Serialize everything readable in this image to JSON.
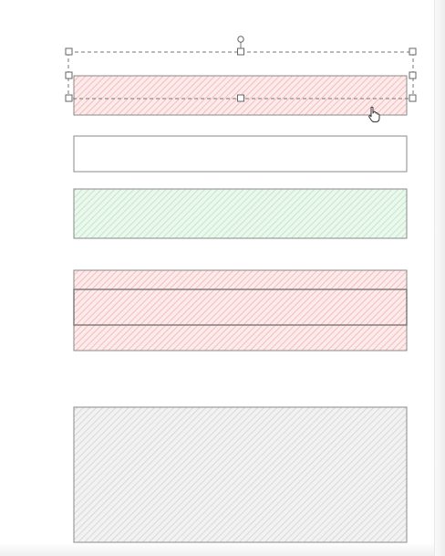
{
  "canvas": {
    "background": "#ffffff",
    "shapes": [
      {
        "name": "shape-red-hatched-selected",
        "fill": "red-hatch",
        "selected": true
      },
      {
        "name": "shape-empty-outline",
        "fill": "none",
        "selected": false
      },
      {
        "name": "shape-green-hatched",
        "fill": "green-hatch",
        "selected": false
      },
      {
        "name": "shape-red-hatched-overlap-outer",
        "fill": "red-hatch",
        "selected": false
      },
      {
        "name": "shape-red-hatched-overlap-inner",
        "fill": "red-hatch",
        "selected": false
      },
      {
        "name": "shape-gray-hatched",
        "fill": "gray-hatch",
        "selected": false
      }
    ]
  },
  "cursor": {
    "icon": "hand-pointer-icon"
  },
  "colors": {
    "red_hatch": "#f1b3b3",
    "red_fill": "#fdeaea",
    "green_hatch": "#b9e3c2",
    "green_fill": "#ebf8ee",
    "gray_hatch": "#cfcfcf",
    "gray_fill": "#f2f2f2",
    "outline": "#8a8a8a",
    "selection": "#777777"
  }
}
